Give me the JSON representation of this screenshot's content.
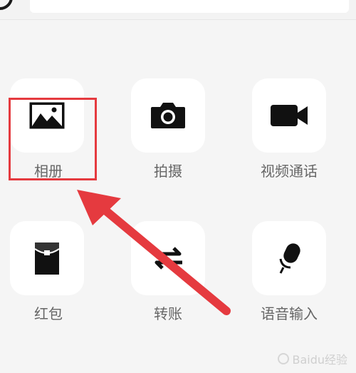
{
  "panel": {
    "items": [
      {
        "label": "相册",
        "icon": "photo-album-icon"
      },
      {
        "label": "拍摄",
        "icon": "camera-icon"
      },
      {
        "label": "视频通话",
        "icon": "video-call-icon"
      },
      {
        "label": "红包",
        "icon": "red-packet-icon"
      },
      {
        "label": "转账",
        "icon": "transfer-icon"
      },
      {
        "label": "语音输入",
        "icon": "microphone-icon"
      }
    ]
  },
  "annotation": {
    "highlight_color": "#e53a3f",
    "arrow_color": "#e53a3f",
    "target": "相册"
  },
  "colors": {
    "background": "#f5f5f5",
    "tile": "#ffffff",
    "icon": "#111111",
    "label": "#666666"
  },
  "watermark": {
    "text": "Baidu经验"
  }
}
